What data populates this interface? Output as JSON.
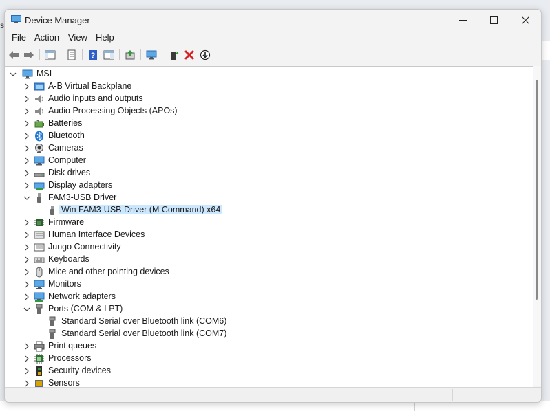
{
  "window": {
    "title": "Device Manager"
  },
  "menu": [
    "File",
    "Action",
    "View",
    "Help"
  ],
  "tree": {
    "root": "MSI",
    "items": [
      {
        "label": "A-B Virtual Backplane",
        "icon": "backplane-icon"
      },
      {
        "label": "Audio inputs and outputs",
        "icon": "speaker-icon"
      },
      {
        "label": "Audio Processing Objects (APOs)",
        "icon": "speaker-icon"
      },
      {
        "label": "Batteries",
        "icon": "battery-icon"
      },
      {
        "label": "Bluetooth",
        "icon": "bluetooth-icon"
      },
      {
        "label": "Cameras",
        "icon": "camera-icon"
      },
      {
        "label": "Computer",
        "icon": "monitor-icon"
      },
      {
        "label": "Disk drives",
        "icon": "disk-drive-icon"
      },
      {
        "label": "Display adapters",
        "icon": "display-adapter-icon"
      },
      {
        "label": "FAM3-USB Driver",
        "icon": "usb-icon",
        "expanded": true,
        "children": [
          {
            "label": "Win FAM3-USB Driver (M Command) x64",
            "icon": "usb-icon",
            "selected": true
          }
        ]
      },
      {
        "label": "Firmware",
        "icon": "chip-icon"
      },
      {
        "label": "Human Interface Devices",
        "icon": "hid-icon"
      },
      {
        "label": "Jungo Connectivity",
        "icon": "jungo-icon"
      },
      {
        "label": "Keyboards",
        "icon": "keyboard-icon"
      },
      {
        "label": "Mice and other pointing devices",
        "icon": "mouse-icon"
      },
      {
        "label": "Monitors",
        "icon": "monitor-icon"
      },
      {
        "label": "Network adapters",
        "icon": "network-icon"
      },
      {
        "label": "Ports (COM & LPT)",
        "icon": "port-icon",
        "expanded": true,
        "children": [
          {
            "label": "Standard Serial over Bluetooth link (COM6)",
            "icon": "port-icon"
          },
          {
            "label": "Standard Serial over Bluetooth link (COM7)",
            "icon": "port-icon"
          }
        ]
      },
      {
        "label": "Print queues",
        "icon": "printer-icon"
      },
      {
        "label": "Processors",
        "icon": "processor-icon"
      },
      {
        "label": "Security devices",
        "icon": "security-icon"
      },
      {
        "label": "Sensors",
        "icon": "sensor-icon"
      }
    ]
  },
  "colors": {
    "selection": "#cce8ff",
    "accent_green": "#2e9b3a",
    "uninstall_red": "#d32020",
    "help_blue": "#2b5fc7"
  }
}
